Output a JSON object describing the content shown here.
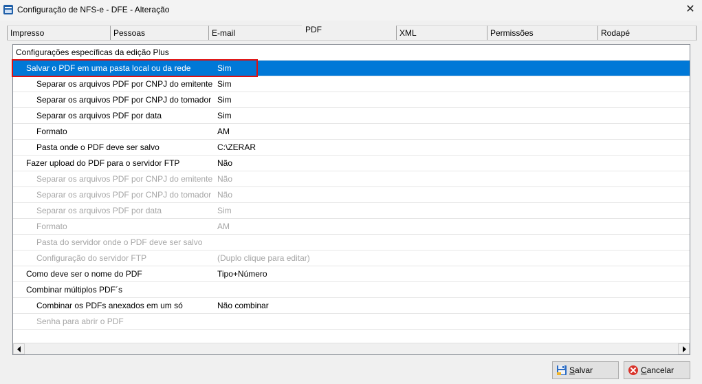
{
  "window": {
    "title": "Configuração de NFS-e - DFE - Alteração",
    "close_glyph": "✕",
    "icon": "nfse-app-icon"
  },
  "tabs": [
    {
      "label": "Impresso",
      "active": false
    },
    {
      "label": "Pessoas",
      "active": false
    },
    {
      "label": "E-mail",
      "active": false
    },
    {
      "label": "PDF",
      "active": true
    },
    {
      "label": "XML",
      "active": false
    },
    {
      "label": "Permissões",
      "active": false
    },
    {
      "label": "Rodapé",
      "active": false
    }
  ],
  "grid": {
    "rows": [
      {
        "label": "Configurações específicas da edição Plus",
        "value": "",
        "level": 0,
        "state": "normal"
      },
      {
        "label": "Salvar o PDF em uma pasta local ou da rede",
        "value": "Sim",
        "level": 1,
        "state": "selected"
      },
      {
        "label": "Separar os arquivos PDF por CNPJ do emitente",
        "value": "Sim",
        "level": 2,
        "state": "normal"
      },
      {
        "label": "Separar os arquivos PDF por CNPJ do tomador",
        "value": "Sim",
        "level": 2,
        "state": "normal"
      },
      {
        "label": "Separar os arquivos PDF por data",
        "value": "Sim",
        "level": 2,
        "state": "normal"
      },
      {
        "label": "Formato",
        "value": "AM",
        "level": 2,
        "state": "normal"
      },
      {
        "label": "Pasta onde o PDF deve ser salvo",
        "value": "C:\\ZERAR",
        "level": 2,
        "state": "normal"
      },
      {
        "label": "Fazer upload do PDF para o servidor FTP",
        "value": "Não",
        "level": 1,
        "state": "normal"
      },
      {
        "label": "Separar os arquivos PDF por CNPJ do emitente",
        "value": "Não",
        "level": 2,
        "state": "disabled"
      },
      {
        "label": "Separar os arquivos PDF por CNPJ do tomador",
        "value": "Não",
        "level": 2,
        "state": "disabled"
      },
      {
        "label": "Separar os arquivos PDF por data",
        "value": "Sim",
        "level": 2,
        "state": "disabled"
      },
      {
        "label": "Formato",
        "value": "AM",
        "level": 2,
        "state": "disabled"
      },
      {
        "label": "Pasta do servidor onde o PDF deve ser salvo",
        "value": "",
        "level": 2,
        "state": "disabled"
      },
      {
        "label": "Configuração do servidor FTP",
        "value": "(Duplo clique para editar)",
        "level": 2,
        "state": "disabled"
      },
      {
        "label": "Como deve ser o nome do PDF",
        "value": "Tipo+Número",
        "level": 1,
        "state": "normal"
      },
      {
        "label": "Combinar múltiplos PDF´s",
        "value": "",
        "level": 1,
        "state": "normal"
      },
      {
        "label": "Combinar os PDFs anexados em um só",
        "value": "Não combinar",
        "level": 2,
        "state": "normal"
      },
      {
        "label": "Senha para abrir o PDF",
        "value": "",
        "level": 2,
        "state": "disabled"
      }
    ]
  },
  "buttons": {
    "save_label": "Salvar",
    "save_icon": "floppy-disk-icon",
    "cancel_label": "Cancelar",
    "cancel_icon": "cancel-icon"
  },
  "colors": {
    "selection": "#0078d7",
    "highlight_border": "#e01010",
    "disabled_text": "#a6a6a6"
  }
}
